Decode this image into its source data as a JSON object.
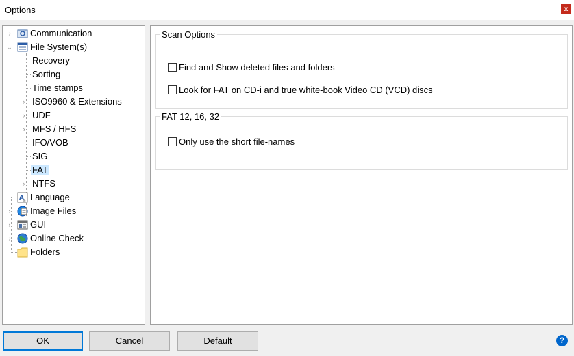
{
  "window": {
    "title": "Options",
    "close_glyph": "x"
  },
  "tree": {
    "items": [
      {
        "label": "Communication",
        "icon": "communication-icon"
      },
      {
        "label": "File System(s)",
        "icon": "filesystem-icon"
      },
      {
        "label": "Recovery"
      },
      {
        "label": "Sorting"
      },
      {
        "label": "Time stamps"
      },
      {
        "label": "ISO9960 & Extensions"
      },
      {
        "label": "UDF"
      },
      {
        "label": "MFS / HFS"
      },
      {
        "label": "IFO/VOB"
      },
      {
        "label": "SIG"
      },
      {
        "label": "FAT"
      },
      {
        "label": "NTFS"
      },
      {
        "label": "Language",
        "icon": "language-icon"
      },
      {
        "label": "Image Files",
        "icon": "image-files-icon"
      },
      {
        "label": "GUI",
        "icon": "gui-icon"
      },
      {
        "label": "Online Check",
        "icon": "globe-icon"
      },
      {
        "label": "Folders",
        "icon": "folder-icon"
      }
    ],
    "selected": "FAT"
  },
  "scan_options": {
    "legend": "Scan Options",
    "options": [
      {
        "label": "Find and Show deleted files and folders",
        "checked": false
      },
      {
        "label": "Look for FAT on CD-i and true white-book Video CD (VCD) discs",
        "checked": false
      }
    ]
  },
  "fat_options": {
    "legend": "FAT 12, 16, 32",
    "options": [
      {
        "label": "Only use the short file-names",
        "checked": false
      }
    ]
  },
  "buttons": {
    "ok": "OK",
    "cancel": "Cancel",
    "default": "Default"
  },
  "help": {
    "glyph": "?"
  },
  "colors": {
    "selection": "#cce8ff",
    "accent": "#0078d7",
    "close": "#c42b1c",
    "help": "#0066cc"
  }
}
